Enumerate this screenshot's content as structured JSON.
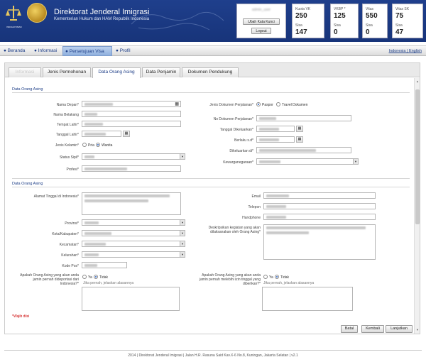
{
  "header": {
    "org_title": "Direktorat Jenderal Imigrasi",
    "org_subtitle": "Kementerian Hukum dan HAM Republik Indonesia",
    "logo_caption": "PENGAYOMAN",
    "user_name": "admin_user",
    "change_password_label": "Ubah Kata Kunci",
    "logout_label": "Logout"
  },
  "stats": [
    {
      "top_label": "Kuota VK",
      "top_value": "250",
      "bottom_label": "Sisa",
      "bottom_value": "147"
    },
    {
      "top_label": "VKBP *",
      "top_value": "125",
      "bottom_label": "Sisa",
      "bottom_value": "0"
    },
    {
      "top_label": "Vitas",
      "top_value": "550",
      "bottom_label": "Sisa",
      "bottom_value": "0"
    },
    {
      "top_label": "Vitas SK",
      "top_value": "75",
      "bottom_label": "Sisa",
      "bottom_value": "47"
    }
  ],
  "nav": {
    "items": [
      "Beranda",
      "Informasi",
      "Persetujuan Visa",
      "Profil"
    ],
    "active": "Persetujuan Visa",
    "lang_id": "Indonesia",
    "lang_sep": "|",
    "lang_en": "English"
  },
  "tabs": [
    "Informasi",
    "Jenis Permohonan",
    "Data Orang Asing",
    "Data Penjamin",
    "Dokumen Pendukung"
  ],
  "section1": {
    "title": "Data Orang Asing",
    "left_labels": {
      "nama_depan": "Nama Depan*",
      "nama_belakang": "Nama Belakang",
      "tempat_lahir": "Tempat Lahir*",
      "tanggal_lahir": "Tanggal Lahir*",
      "jenis_kelamin": "Jenis Kelamin*",
      "status_sipil": "Status Sipil*",
      "profesi": "Profesi*"
    },
    "gender_options": [
      "Pria",
      "Wanita"
    ],
    "right_labels": {
      "jenis_dokumen": "Jenis Dokumen Perjalanan*",
      "no_dokumen": "No Dokumen Perjalanan*",
      "tanggal_dikeluarkan": "Tanggal Dikeluarkan*",
      "berlaku_sd": "Berlaku s.d*",
      "dikeluarkan_di": "Dikeluarkan di*",
      "kewarganegaraan": "Kewarganegaraan*"
    },
    "doc_options": [
      "Paspor",
      "Travel Dokumen"
    ]
  },
  "section2": {
    "title": "Data Orang Asing",
    "left_labels": {
      "alamat": "Alamat Tinggal di Indonesia*",
      "provinsi": "Provinsi*",
      "kota": "Kota/Kabupaten*",
      "kecamatan": "Kecamatan*",
      "kelurahan": "Kelurahan*",
      "kode_pos": "Kode Pos*"
    },
    "right_labels": {
      "email": "Email",
      "telepon": "Telepon",
      "handphone": "Handphone",
      "kegiatan": "Deskripsikan kegiatan yang akan dilaksanakan oleh Orang Asing*"
    },
    "question_left": "Apakah Orang Asing yang akan anda jamin pernah dideportasi dari Indonesia?*",
    "question_right": "Apakah Orang Asing yang akan anda jamin pernah melebihi izin tinggal yang diberikan?*",
    "yes_label": "Ya",
    "no_label": "Tidak",
    "explain_placeholder": "Jika pernah, jelaskan alasannya"
  },
  "required_note": "*Wajib diisi",
  "buttons": {
    "reset": "Batal",
    "back": "Kembali",
    "next": "Lanjutkan"
  },
  "footer": "2014 | Direktorat Jenderal Imigrasi | Jalan H.R. Rasuna Said Kav.X-6 No.8, Kuningan, Jakarta Selatan | v2.1"
}
